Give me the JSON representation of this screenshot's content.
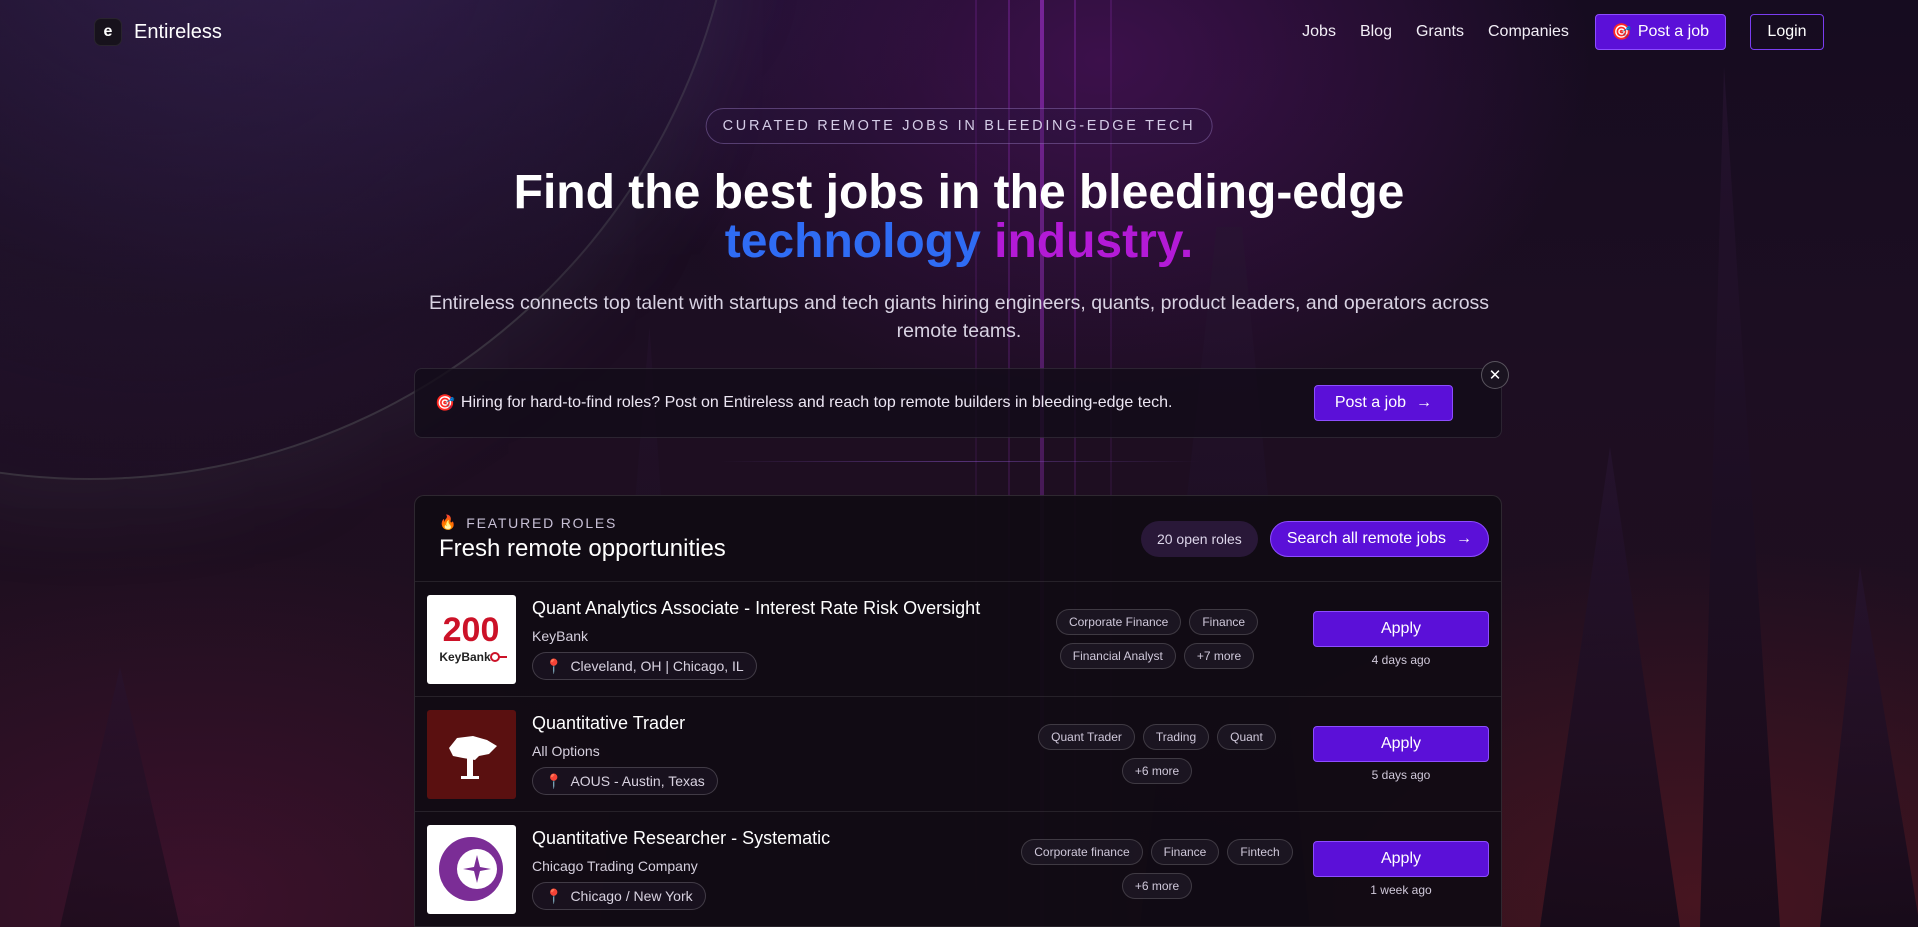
{
  "nav": {
    "brand": "Entireless",
    "logo_glyph": "e",
    "links": [
      "Jobs",
      "Blog",
      "Grants",
      "Companies"
    ],
    "post_job_label": "Post a job",
    "login_label": "Login"
  },
  "hero": {
    "eyebrow": "CURATED REMOTE JOBS IN BLEEDING-EDGE TECH",
    "title_line1": "Find the best jobs in the bleeding-edge",
    "title_word_blue": "technology",
    "title_word_purple": "industry.",
    "subtitle": "Entireless connects top talent with startups and tech giants hiring engineers, quants, product leaders, and operators across remote teams."
  },
  "banner": {
    "text": "Hiring for hard-to-find roles? Post on Entireless and reach top remote builders in bleeding-edge tech.",
    "button_label": "Post a job"
  },
  "featured": {
    "eyebrow": "FEATURED ROLES",
    "title": "Fresh remote opportunities",
    "count_label": "20 open roles",
    "search_label": "Search all remote jobs",
    "jobs": [
      {
        "title": "Quant Analytics Associate - Interest Rate Risk Oversight",
        "company": "KeyBank",
        "location": "Cleveland, OH | Chicago, IL",
        "tags": [
          "Corporate Finance",
          "Finance",
          "Financial Analyst",
          "+7 more"
        ],
        "apply_label": "Apply",
        "posted": "4 days ago",
        "logo": {
          "text_big": "200",
          "text_small": "KeyBank"
        }
      },
      {
        "title": "Quantitative Trader",
        "company": "All Options",
        "location": "AOUS - Austin, Texas",
        "tags": [
          "Quant Trader",
          "Trading",
          "Quant",
          "+6 more"
        ],
        "apply_label": "Apply",
        "posted": "5 days ago"
      },
      {
        "title": "Quantitative Researcher - Systematic",
        "company": "Chicago Trading Company",
        "location": "Chicago / New York",
        "tags": [
          "Corporate finance",
          "Finance",
          "Fintech",
          "+6 more"
        ],
        "apply_label": "Apply",
        "posted": "1 week ago"
      }
    ]
  },
  "colors": {
    "accent": "#5b10d8",
    "accent_border": "#8d4dff",
    "title_blue": "#2f6cf4",
    "title_purple": "#b31ad6"
  }
}
